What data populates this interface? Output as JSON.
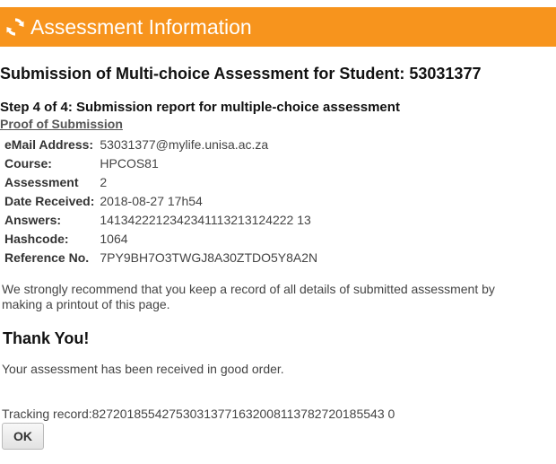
{
  "header": {
    "title": "Assessment Information",
    "icon": "refresh-icon",
    "color": "#f7941d"
  },
  "main_title": "Submission of Multi-choice Assessment for Student: 53031377",
  "step_title": "Step 4 of 4: Submission report for multiple-choice assessment",
  "proof_link": "Proof of Submission",
  "details": [
    {
      "label": "eMail Address:",
      "value": "53031377@mylife.unisa.ac.za"
    },
    {
      "label": "Course:",
      "value": "HPCOS81"
    },
    {
      "label": "Assessment",
      "value": "2"
    },
    {
      "label": "Date Received:",
      "value": "2018-08-27 17h54"
    },
    {
      "label": "Answers:",
      "value": "1413422212342341113213124222 13"
    },
    {
      "label": "Hashcode:",
      "value": "1064"
    },
    {
      "label": "Reference No.",
      "value": "7PY9BH7O3TWGJ8A30ZTDO5Y8A2N"
    }
  ],
  "recommend_text": "We strongly recommend that you keep a record of all details of submitted assessment by making a printout of this page.",
  "thanks": "Thank You!",
  "received_text": "Your assessment has been received in good order.",
  "tracking_text": "Tracking record:827201855427530313771632008113782720185543 0",
  "ok_button": "OK"
}
